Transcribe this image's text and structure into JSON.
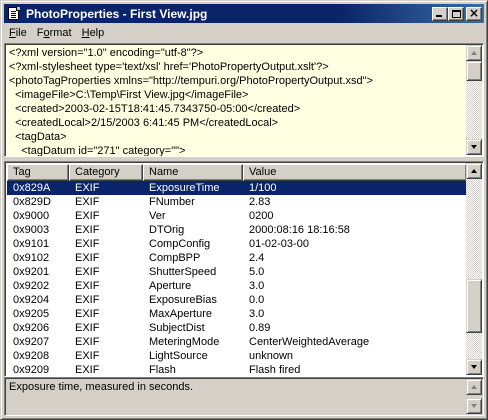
{
  "window": {
    "title": "PhotoProperties - First View.jpg",
    "minimize_glyph": "",
    "close_glyph": "×"
  },
  "menu": {
    "items": [
      {
        "underline": "F",
        "rest": "ile"
      },
      {
        "before": "F",
        "underline": "o",
        "rest": "rmat"
      },
      {
        "underline": "H",
        "rest": "elp"
      }
    ]
  },
  "xml": {
    "lines": [
      "<?xml version=\"1.0\" encoding=\"utf-8\"?>",
      "<?xml-stylesheet type='text/xsl' href='PhotoPropertyOutput.xslt'?>",
      "<photoTagProperties xmlns=\"http://tempuri.org/PhotoPropertyOutput.xsd\">",
      "  <imageFile>C:\\Temp\\First View.jpg</imageFile>",
      "  <created>2003-02-15T18:41:45.7343750-05:00</created>",
      "  <createdLocal>2/15/2003 6:41:45 PM</createdLocal>",
      "  <tagData>",
      "    <tagDatum id=\"271\" category=\"\">"
    ]
  },
  "list": {
    "columns": [
      {
        "label": "Tag"
      },
      {
        "label": "Category"
      },
      {
        "label": "Name"
      },
      {
        "label": "Value"
      }
    ],
    "rows": [
      {
        "tag": "0x829A",
        "category": "EXIF",
        "name": "ExposureTime",
        "value": "1/100",
        "selected": true
      },
      {
        "tag": "0x829D",
        "category": "EXIF",
        "name": "FNumber",
        "value": "2.83"
      },
      {
        "tag": "0x9000",
        "category": "EXIF",
        "name": "Ver",
        "value": "0200"
      },
      {
        "tag": "0x9003",
        "category": "EXIF",
        "name": "DTOrig",
        "value": "2000:08:16 18:16:58"
      },
      {
        "tag": "0x9101",
        "category": "EXIF",
        "name": "CompConfig",
        "value": "01-02-03-00"
      },
      {
        "tag": "0x9102",
        "category": "EXIF",
        "name": "CompBPP",
        "value": "2.4"
      },
      {
        "tag": "0x9201",
        "category": "EXIF",
        "name": "ShutterSpeed",
        "value": "5.0"
      },
      {
        "tag": "0x9202",
        "category": "EXIF",
        "name": "Aperture",
        "value": "3.0"
      },
      {
        "tag": "0x9204",
        "category": "EXIF",
        "name": "ExposureBias",
        "value": "0.0"
      },
      {
        "tag": "0x9205",
        "category": "EXIF",
        "name": "MaxAperture",
        "value": "3.0"
      },
      {
        "tag": "0x9206",
        "category": "EXIF",
        "name": "SubjectDist",
        "value": "0.89"
      },
      {
        "tag": "0x9207",
        "category": "EXIF",
        "name": "MeteringMode",
        "value": "CenterWeightedAverage"
      },
      {
        "tag": "0x9208",
        "category": "EXIF",
        "name": "LightSource",
        "value": "unknown"
      },
      {
        "tag": "0x9209",
        "category": "EXIF",
        "name": "Flash",
        "value": "Flash fired"
      }
    ]
  },
  "status": {
    "description": "Exposure time, measured in seconds."
  },
  "colors": {
    "titlebar": "#0a246a",
    "selection": "#0a246a",
    "xml_background": "#ffffe1",
    "face": "#d4d0c8"
  }
}
